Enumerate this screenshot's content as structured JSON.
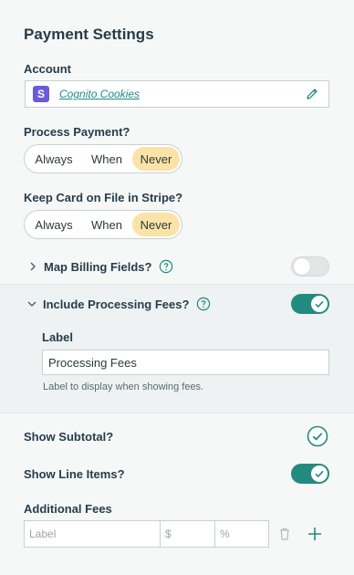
{
  "title": "Payment Settings",
  "account": {
    "label": "Account",
    "value": "Cognito Cookies",
    "logo_letter": "S",
    "logo_color": "#6a5bdc"
  },
  "process_payment": {
    "label": "Process Payment?",
    "options": [
      "Always",
      "When",
      "Never"
    ],
    "selected": "Never"
  },
  "keep_card": {
    "label": "Keep Card on File in Stripe?",
    "options": [
      "Always",
      "When",
      "Never"
    ],
    "selected": "Never"
  },
  "map_billing": {
    "label": "Map Billing Fields?",
    "enabled": false
  },
  "processing_fees": {
    "label": "Include Processing Fees?",
    "enabled": true,
    "field_label": "Label",
    "field_value": "Processing Fees",
    "field_help": "Label to display when showing fees."
  },
  "show_subtotal": {
    "label": "Show Subtotal?",
    "checked": true
  },
  "show_line_items": {
    "label": "Show Line Items?",
    "enabled": true
  },
  "additional_fees": {
    "label": "Additional Fees",
    "label_placeholder": "Label",
    "amount_placeholder": "$",
    "percent_placeholder": "%"
  },
  "colors": {
    "accent": "#238a80",
    "selected_segment": "#fbe3a8",
    "heading": "#263d4a",
    "link": "#1f8a8a"
  }
}
